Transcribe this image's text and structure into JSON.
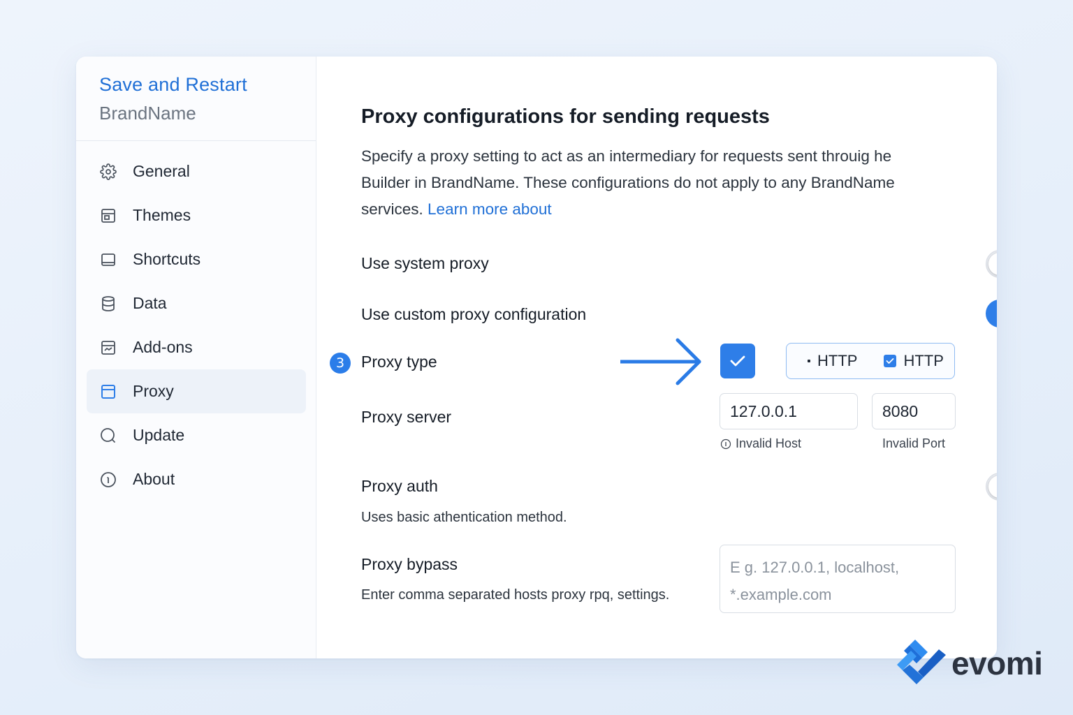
{
  "sidebar": {
    "save_restart": "Save and Restart",
    "brand": "BrandName",
    "items": [
      {
        "label": "General",
        "icon": "gear-icon"
      },
      {
        "label": "Themes",
        "icon": "palette-icon"
      },
      {
        "label": "Shortcuts",
        "icon": "keyboard-icon"
      },
      {
        "label": "Data",
        "icon": "database-icon"
      },
      {
        "label": "Add-ons",
        "icon": "puzzle-icon"
      },
      {
        "label": "Proxy",
        "icon": "window-icon",
        "active": true
      },
      {
        "label": "Update",
        "icon": "refresh-icon"
      },
      {
        "label": "About",
        "icon": "info-icon"
      }
    ]
  },
  "main": {
    "title": "Proxy configurations for sending requests",
    "description_1": "Specify a proxy setting to act as an intermediary for requests sent throuig he",
    "description_2": "Builder in BrandName. These configurations do not apply to any BrandName",
    "description_3": "services.",
    "learn_more": "Learn more about",
    "system_proxy": {
      "label": "Use system proxy",
      "enabled": false
    },
    "custom_proxy": {
      "label": "Use custom proxy configuration",
      "enabled": true
    },
    "proxy_type": {
      "step": "3",
      "label": "Proxy type",
      "checked": true,
      "option_1": "HTTP",
      "option_2": "HTTP"
    },
    "proxy_server": {
      "label": "Proxy server",
      "host": "127.0.0.1",
      "port": "8080",
      "host_error": "Invalid Host",
      "port_error": "Invalid Port"
    },
    "proxy_auth": {
      "label": "Proxy auth",
      "description": "Uses basic athentication method.",
      "enabled": false
    },
    "proxy_bypass": {
      "label": "Proxy bypass",
      "description": "Enter comma separated hosts proxy rpq, settings.",
      "placeholder_1": "E g. 127.0.0.1, localhost,",
      "placeholder_2": "*.example.com"
    }
  },
  "logo": {
    "text": "evomi"
  },
  "colors": {
    "accent": "#2e7ee8",
    "link": "#1f6fd6",
    "text": "#151c26"
  }
}
